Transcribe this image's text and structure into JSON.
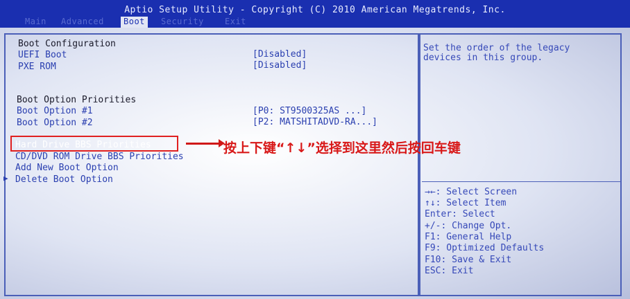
{
  "title": "Aptio Setup Utility - Copyright (C) 2010 American Megatrends, Inc.",
  "tabs": [
    {
      "label": "Main"
    },
    {
      "label": "Advanced"
    },
    {
      "label": "Boot"
    },
    {
      "label": "Security"
    },
    {
      "label": "Exit"
    }
  ],
  "main": {
    "boot_config_header": "Boot Configuration",
    "uefi_boot": {
      "label": "UEFI Boot",
      "value": "[Disabled]"
    },
    "pxe_rom": {
      "label": "PXE ROM",
      "value": "[Disabled]"
    },
    "priorities_header": "Boot Option Priorities",
    "boot_option_1": {
      "label": "Boot Option #1",
      "value": "[P0: ST9500325AS    ...]"
    },
    "boot_option_2": {
      "label": "Boot Option #2",
      "value": "[P2: MATSHITADVD-RA...]"
    },
    "hdd_bbs": "Hard Drive BBS Priorities",
    "cddvd_bbs": "CD/DVD ROM Drive BBS Priorities",
    "add_boot": "Add New Boot Option",
    "delete_boot": "Delete Boot Option",
    "submenu_marker": "▶"
  },
  "help": {
    "line1": "Set the order of the legacy",
    "line2": "devices in this group.",
    "keys": [
      "→←: Select Screen",
      "↑↓: Select Item",
      "Enter: Select",
      "+/-: Change Opt.",
      "F1: General Help",
      "F9: Optimized Defaults",
      "F10: Save & Exit",
      "ESC: Exit"
    ]
  },
  "annotation": "按上下键“↑↓”选择到这里然后按回车键",
  "colors": {
    "accent": "#1a2fb0",
    "annotation": "#d81818"
  }
}
